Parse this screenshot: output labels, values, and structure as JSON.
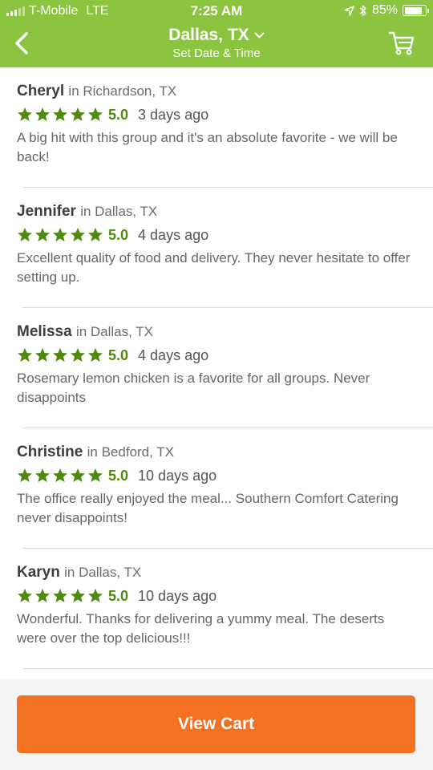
{
  "status_bar": {
    "carrier": "T-Mobile",
    "network": "LTE",
    "time": "7:25 AM",
    "battery": "85%",
    "battery_level": 0.85
  },
  "header": {
    "city": "Dallas, TX",
    "subtitle": "Set Date & Time",
    "back_icon": "chevron-left-icon",
    "cart_icon": "shopping-cart-icon",
    "background_color": "#8bc53f"
  },
  "reviews": [
    {
      "name": "Cheryl",
      "location": "in Richardson, TX",
      "rating": 5,
      "score": "5.0",
      "ago": "3 days ago",
      "text": "A big hit with this group and it's an absolute favorite - we will be back!"
    },
    {
      "name": "Jennifer",
      "location": "in Dallas, TX",
      "rating": 5,
      "score": "5.0",
      "ago": "4 days ago",
      "text": "Excellent quality of food and delivery. They never hesitate to offer setting up."
    },
    {
      "name": "Melissa",
      "location": "in Dallas, TX",
      "rating": 5,
      "score": "5.0",
      "ago": "4 days ago",
      "text": "Rosemary lemon chicken is a favorite for all groups. Never disappoints"
    },
    {
      "name": "Christine",
      "location": "in Bedford, TX",
      "rating": 5,
      "score": "5.0",
      "ago": "10 days ago",
      "text": "The office really enjoyed the meal... Southern Comfort Catering never disappoints!"
    },
    {
      "name": "Karyn",
      "location": "in Dallas, TX",
      "rating": 5,
      "score": "5.0",
      "ago": "10 days ago",
      "text": "Wonderful. Thanks for delivering a yummy meal. The deserts were over the top delicious!!!"
    }
  ],
  "star_color": "#4f8a10",
  "footer": {
    "view_cart_label": "View Cart",
    "button_color": "#f47121"
  }
}
